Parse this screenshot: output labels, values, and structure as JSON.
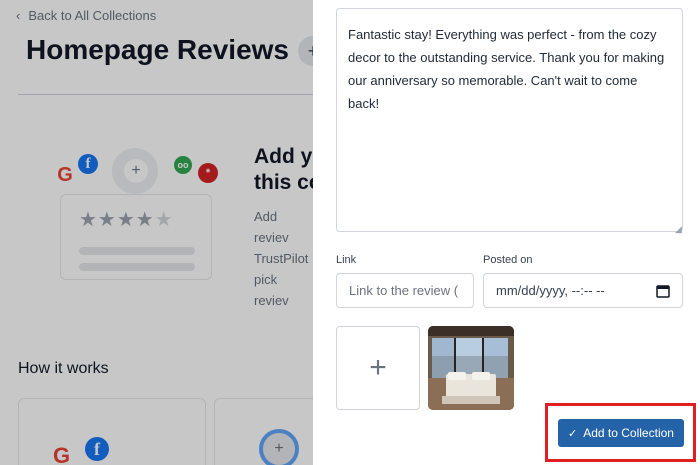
{
  "background": {
    "back_link": "Back to All Collections",
    "page_title": "Homepage Reviews",
    "title_badge": "+",
    "add_heading_line1": "Add yo",
    "add_heading_line2": "this co",
    "add_desc_line1": "Add reviev",
    "add_desc_line2": "TrustPilot",
    "add_desc_line3": "pick reviev",
    "how_title": "How it works",
    "illustration": {
      "google_glyph": "G",
      "facebook_glyph": "f",
      "plus_glyph": "+",
      "tripadvisor_glyph": "oo",
      "yelp_glyph": "*",
      "stars": "★★★★",
      "star_last": "★",
      "rating": 4
    }
  },
  "panel": {
    "review_text": "Fantastic stay! Everything was perfect - from the cozy decor to the outstanding service. Thank you for making our anniversary so memorable. Can't wait to come back!",
    "link_label": "Link",
    "link_placeholder": "Link to the review (",
    "posted_label": "Posted on",
    "date_placeholder": "mm/dd/yyyy, --:-- --",
    "upload_glyph": "+",
    "add_button_label": "Add to Collection",
    "check_glyph": "✓"
  },
  "colors": {
    "primary_button": "#2563a8",
    "highlight_box": "#e02020",
    "facebook": "#1877f2",
    "google": "#ea4335",
    "yelp": "#d32323",
    "tripadvisor": "#34a853"
  }
}
